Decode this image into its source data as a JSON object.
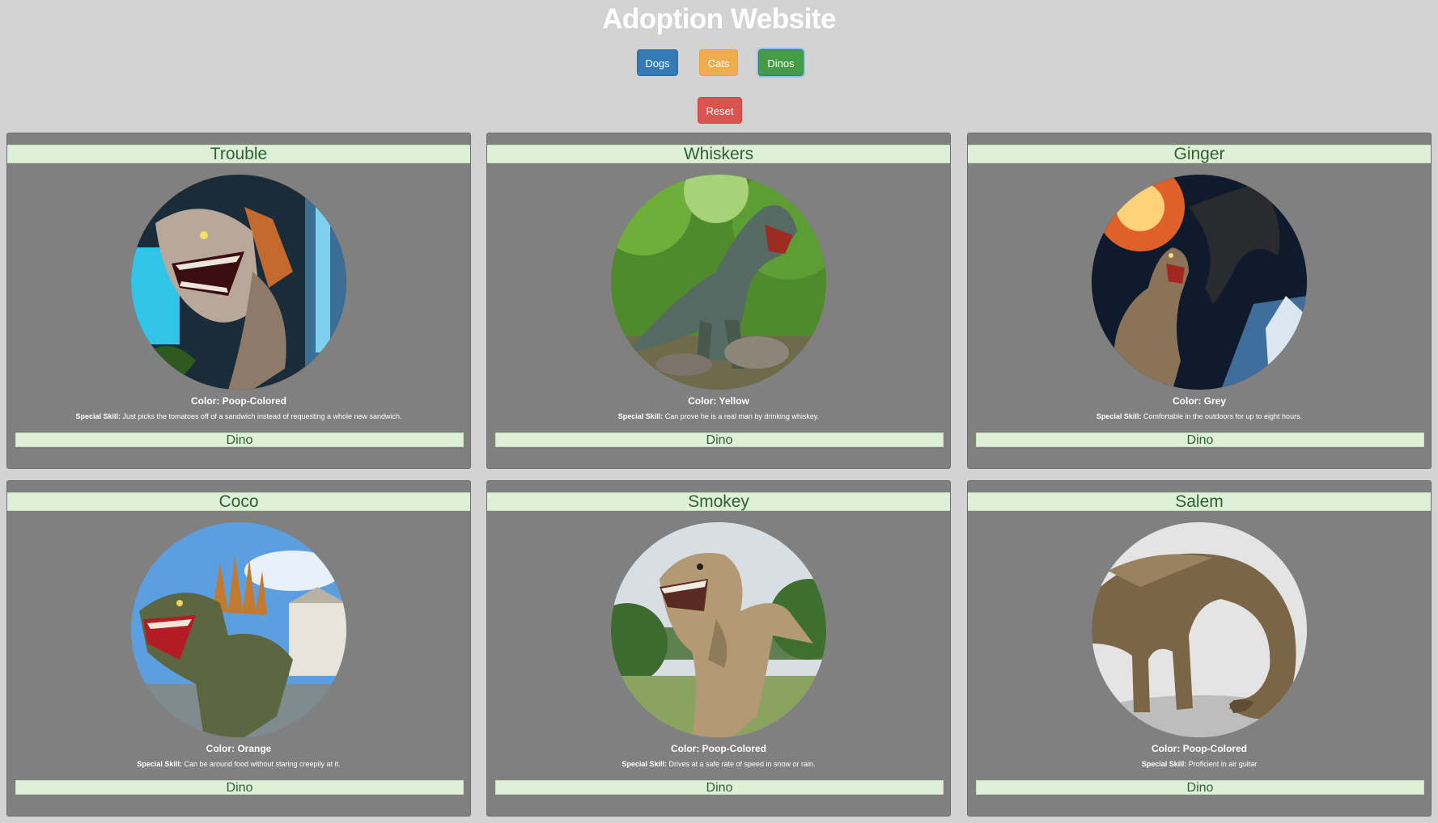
{
  "header": {
    "title": "Adoption Website"
  },
  "filters": {
    "dogs_label": "Dogs",
    "cats_label": "Cats",
    "dinos_label": "Dinos",
    "reset_label": "Reset",
    "active": "Dinos"
  },
  "pets": [
    {
      "name": "Trouble",
      "color_label": "Color: Poop-Colored",
      "skill_label": "Special Skill:",
      "skill": "Just picks the tomatoes off of a sandwich instead of requesting a whole new sandwich.",
      "type": "Dino",
      "image_subject": "spinosaurus-roaring-waterfall"
    },
    {
      "name": "Whiskers",
      "color_label": "Color: Yellow",
      "skill_label": "Special Skill:",
      "skill": "Can prove he is a real man by drinking whiskey.",
      "type": "Dino",
      "image_subject": "t-rex-in-forest"
    },
    {
      "name": "Ginger",
      "color_label": "Color: Grey",
      "skill_label": "Special Skill:",
      "skill": "Comfortable in the outdoors for up to eight hours.",
      "type": "Dino",
      "image_subject": "t-rex-and-pterosaur-meteor"
    },
    {
      "name": "Coco",
      "color_label": "Color: Orange",
      "skill_label": "Special Skill:",
      "skill": "Can be around food without staring creepily at it.",
      "type": "Dino",
      "image_subject": "dimetrodon-model"
    },
    {
      "name": "Smokey",
      "color_label": "Color: Poop-Colored",
      "skill_label": "Special Skill:",
      "skill": "Drives at a safe rate of speed in snow or rain.",
      "type": "Dino",
      "image_subject": "t-rex-in-meadow"
    },
    {
      "name": "Salem",
      "color_label": "Color: Poop-Colored",
      "skill_label": "Special Skill:",
      "skill": "Proficient in air guitar",
      "type": "Dino",
      "image_subject": "sauropod-grazing"
    }
  ]
}
